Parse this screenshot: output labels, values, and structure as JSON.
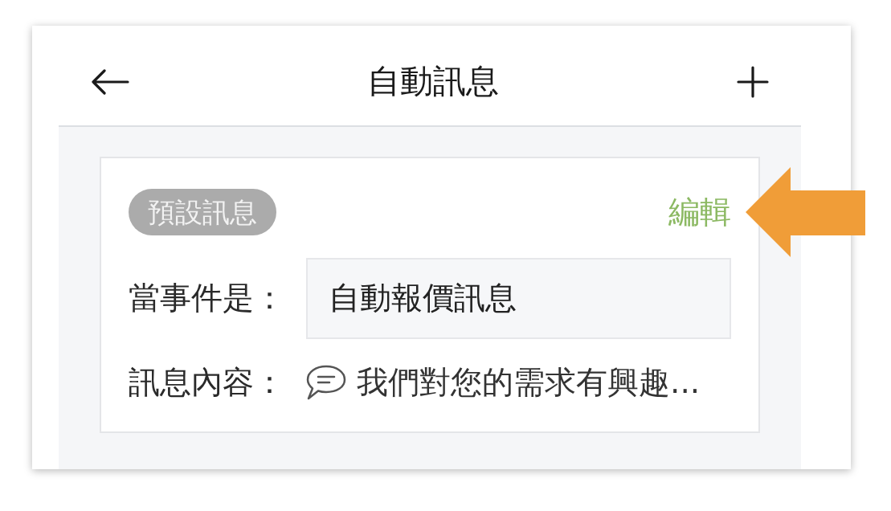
{
  "header": {
    "title": "自動訊息"
  },
  "messages": [
    {
      "tag": "預設訊息",
      "edit_link": "編輯",
      "fields": [
        {
          "kind": "input",
          "label": "當事件是：",
          "value": "自動報價訊息"
        },
        {
          "kind": "preview",
          "label": "訊息內容：",
          "value": "我們對您的需求有興趣..."
        }
      ]
    }
  ]
}
